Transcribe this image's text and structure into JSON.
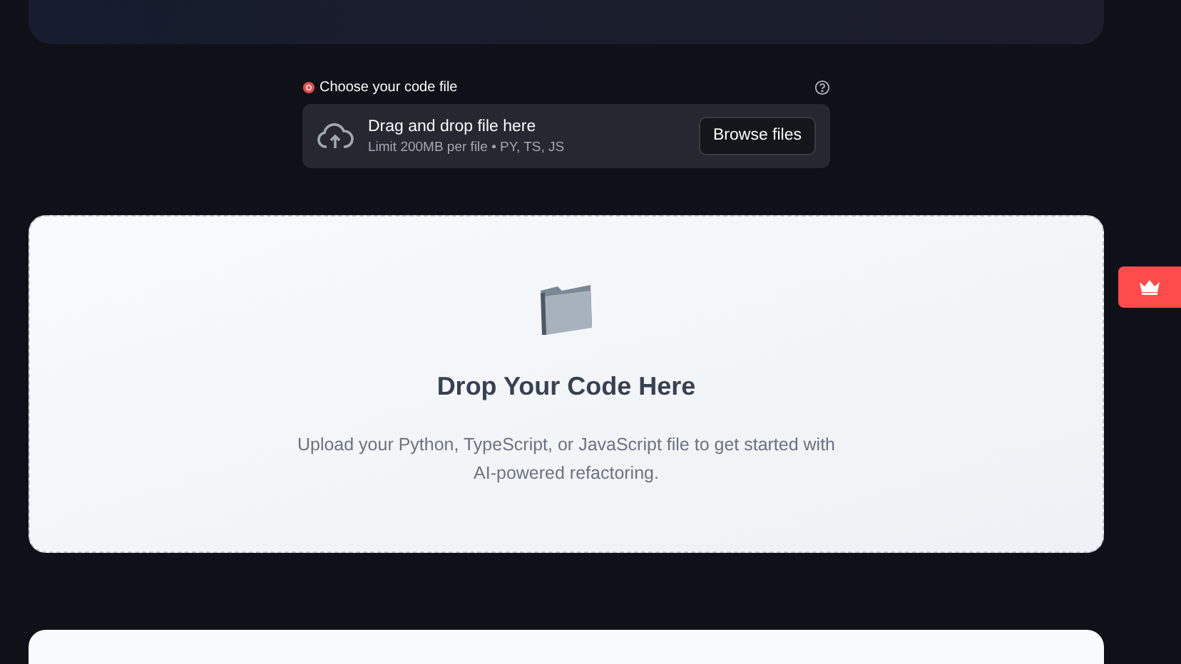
{
  "uploader": {
    "label": "Choose your code file",
    "title": "Drag and drop file here",
    "subtitle": "Limit 200MB per file • PY, TS, JS",
    "button": "Browse files"
  },
  "drop_card": {
    "heading": "Drop Your Code Here",
    "description": "Upload your Python, TypeScript, or JavaScript file to get started with AI-powered refactoring."
  }
}
